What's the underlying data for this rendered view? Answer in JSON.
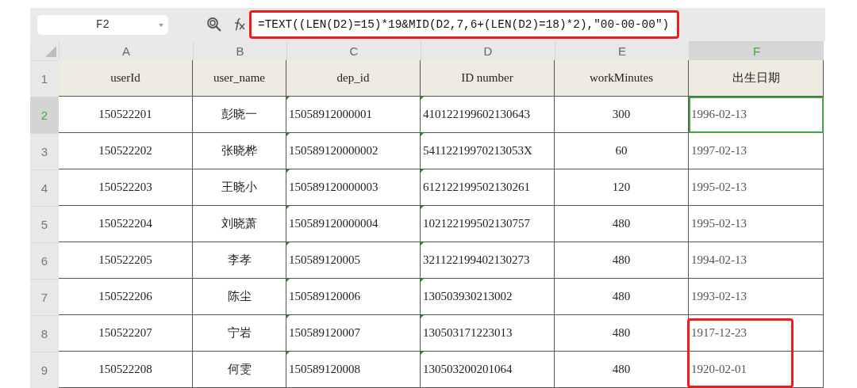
{
  "formula_bar": {
    "name_box": "F2",
    "formula": "=TEXT((LEN(D2)=15)*19&MID(D2,7,6+(LEN(D2)=18)*2),\"00-00-00\")",
    "highlighted": true
  },
  "columns": [
    {
      "letter": "A",
      "selected": false,
      "text_flag": false
    },
    {
      "letter": "B",
      "selected": false,
      "text_flag": false
    },
    {
      "letter": "C",
      "selected": false,
      "text_flag": true
    },
    {
      "letter": "D",
      "selected": false,
      "text_flag": true
    },
    {
      "letter": "E",
      "selected": false,
      "text_flag": false
    },
    {
      "letter": "F",
      "selected": true,
      "text_flag": false
    }
  ],
  "header_row": {
    "number": "1",
    "selected": false,
    "cells": [
      "userId",
      "user_name",
      "dep_id",
      "ID number",
      "workMinutes",
      "出生日期"
    ]
  },
  "rows": [
    {
      "number": "2",
      "selected": true,
      "highlighted": false,
      "cells": [
        "150522201",
        "彭晓一",
        "15058912000001",
        "410122199602130643",
        "300",
        "1996-02-13"
      ]
    },
    {
      "number": "3",
      "selected": false,
      "highlighted": false,
      "cells": [
        "150522202",
        "张晓桦",
        "150589120000002",
        "54112219970213053X",
        "60",
        "1997-02-13"
      ]
    },
    {
      "number": "4",
      "selected": false,
      "highlighted": false,
      "cells": [
        "150522203",
        "王晓小",
        "150589120000003",
        "612122199502130261",
        "120",
        "1995-02-13"
      ]
    },
    {
      "number": "5",
      "selected": false,
      "highlighted": false,
      "cells": [
        "150522204",
        "刘晓萧",
        "150589120000004",
        "102122199502130757",
        "480",
        "1995-02-13"
      ]
    },
    {
      "number": "6",
      "selected": false,
      "highlighted": false,
      "cells": [
        "150522205",
        "李孝",
        "150589120005",
        "321122199402130273",
        "480",
        "1994-02-13"
      ]
    },
    {
      "number": "7",
      "selected": false,
      "highlighted": false,
      "cells": [
        "150522206",
        "陈尘",
        "150589120006",
        "130503930213002",
        "480",
        "1993-02-13"
      ]
    },
    {
      "number": "8",
      "selected": false,
      "highlighted": true,
      "cells": [
        "150522207",
        "宁岩",
        "150589120007",
        "130503171223013",
        "480",
        "1917-12-23"
      ]
    },
    {
      "number": "9",
      "selected": false,
      "highlighted": true,
      "cells": [
        "150522208",
        "何雯",
        "150589120008",
        "130503200201064",
        "480",
        "1920-02-01"
      ]
    }
  ]
}
